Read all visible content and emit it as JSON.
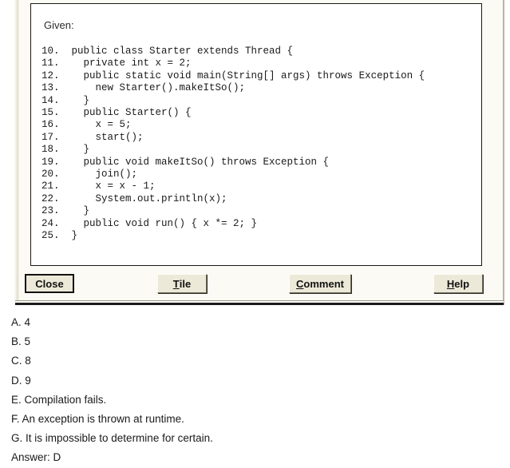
{
  "dialog": {
    "given_label": "Given:",
    "code_lines": [
      "10.  public class Starter extends Thread {",
      "11.    private int x = 2;",
      "12.    public static void main(String[] args) throws Exception {",
      "13.      new Starter().makeItSo();",
      "14.    }",
      "15.    public Starter() {",
      "16.      x = 5;",
      "17.      start();",
      "18.    }",
      "19.    public void makeItSo() throws Exception {",
      "20.      join();",
      "21.      x = x - 1;",
      "22.      System.out.println(x);",
      "23.    }",
      "24.    public void run() { x *= 2; }",
      "25.  }"
    ],
    "buttons": [
      {
        "name": "close",
        "label": "Close",
        "mnemonic": "",
        "default": true
      },
      {
        "name": "tile",
        "label": "Tile",
        "mnemonic": "T",
        "default": false
      },
      {
        "name": "comment",
        "label": "Comment",
        "mnemonic": "C",
        "default": false
      },
      {
        "name": "help",
        "label": "Help",
        "mnemonic": "H",
        "default": false
      }
    ]
  },
  "answers": {
    "options": [
      "A. 4",
      "B. 5",
      "C. 8",
      "D. 9",
      "E. Compilation fails.",
      "F. An exception is thrown at runtime.",
      "G. It is impossible to determine for certain."
    ],
    "answer_line": "Answer: D"
  },
  "colors": {
    "dialog_face": "#ece9d8",
    "panel_background": "#ffffff",
    "text": "#1a1a1a",
    "border_dark": "#1a1a1a"
  }
}
